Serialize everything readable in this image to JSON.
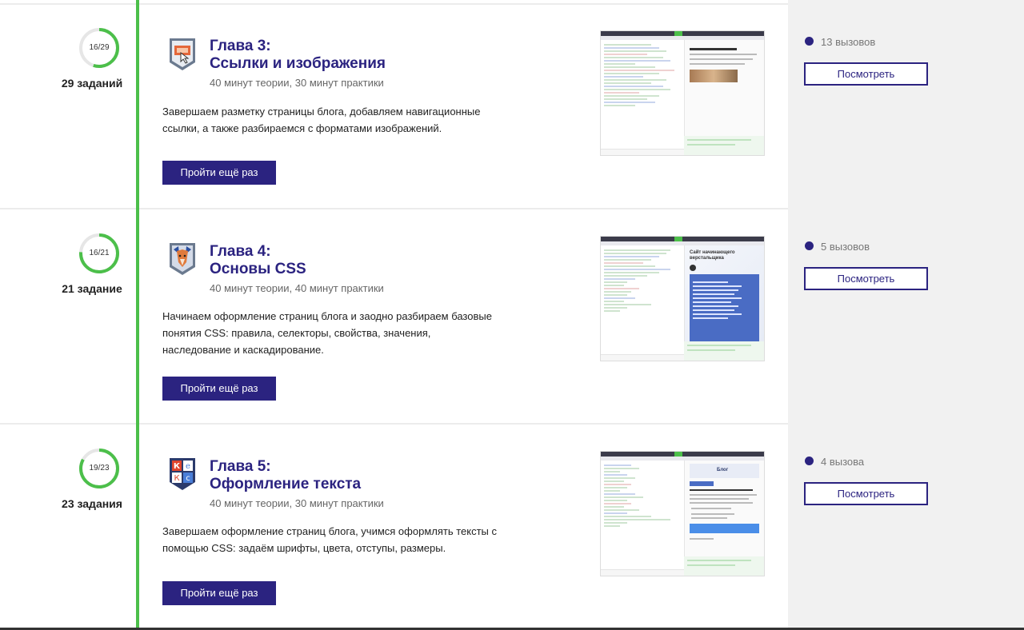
{
  "colors": {
    "accent": "#2b2380",
    "timeline": "#4cbf4a"
  },
  "chapters": [
    {
      "progress": "16/29",
      "progress_fraction": 0.55,
      "tasks": "29 заданий",
      "title_line1": "Глава 3:",
      "title_line2": "Ссылки и изображения",
      "meta": "40 минут теории, 30 минут практики",
      "description": "Завершаем разметку страницы блога, добавляем навигационные ссылки, а также разбираемся с форматами изображений.",
      "button": "Пройти ещё раз",
      "badge_icon": "image-link-badge-icon",
      "challenges": "13 вызовов",
      "view_button": "Посмотреть"
    },
    {
      "progress": "16/21",
      "progress_fraction": 0.76,
      "tasks": "21 задание",
      "title_line1": "Глава 4:",
      "title_line2": "Основы CSS",
      "meta": "40 минут теории, 40 минут практики",
      "description": "Начинаем оформление страниц блога и заодно разбираем базовые понятия CSS: правила, селекторы, свойства, значения, наследование и каскадирование.",
      "button": "Пройти ещё раз",
      "badge_icon": "fox-badge-icon",
      "challenges": "5 вызовов",
      "view_button": "Посмотреть"
    },
    {
      "progress": "19/23",
      "progress_fraction": 0.83,
      "tasks": "23 задания",
      "title_line1": "Глава 5:",
      "title_line2": "Оформление текста",
      "meta": "40 минут теории, 30 минут практики",
      "description": "Завершаем оформление страниц блога, учимся оформлять тексты с помощью CSS: задаём шрифты, цвета, отступы, размеры.",
      "button": "Пройти ещё раз",
      "badge_icon": "letters-badge-icon",
      "challenges": "4 вызова",
      "view_button": "Посмотреть"
    }
  ],
  "previews": [
    {
      "heading": ""
    },
    {
      "heading": "Сайт начинающего верстальщика"
    },
    {
      "heading": "Блог"
    }
  ]
}
